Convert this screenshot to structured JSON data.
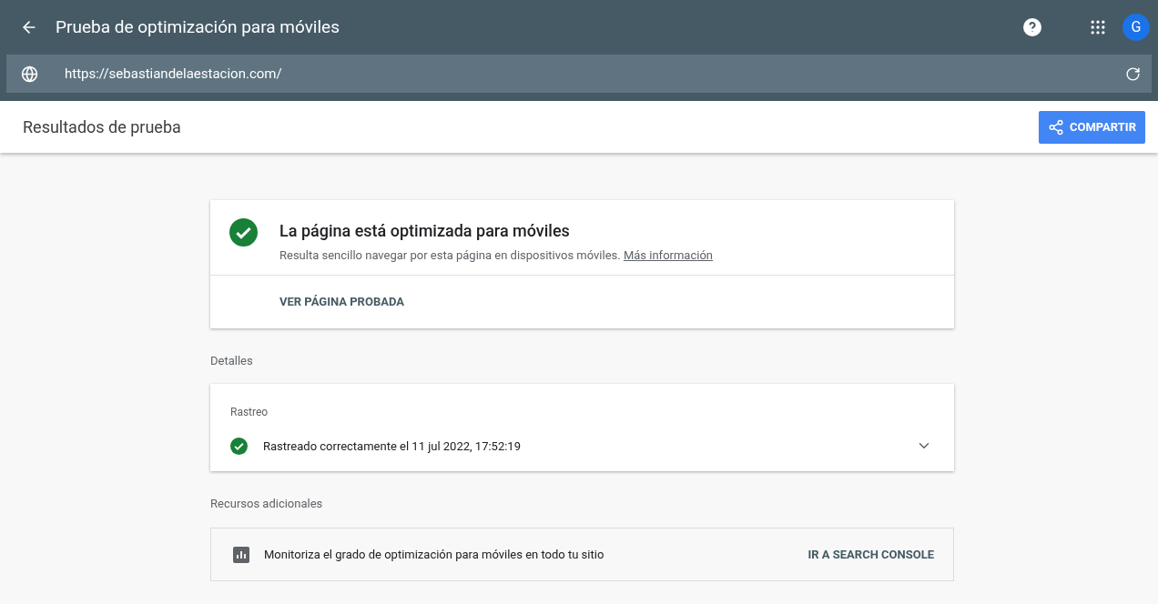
{
  "app_bar": {
    "title": "Prueba de optimización para móviles",
    "avatar": "G"
  },
  "url_bar": {
    "value": "https://sebastiandelaestacion.com/"
  },
  "results_header": {
    "title": "Resultados de prueba",
    "share_button": "COMPARTIR"
  },
  "verdict": {
    "title": "La página está optimizada para móviles",
    "description": "Resulta sencillo navegar por esta página en dispositivos móviles.",
    "link": "Más información",
    "action": "VER PÁGINA PROBADA"
  },
  "details": {
    "heading": "Detalles",
    "card_title": "Rastreo",
    "status": "Rastreado correctamente el 11 jul 2022, 17:52:19",
    "expanded": false
  },
  "resources": {
    "heading": "Recursos adicionales",
    "text": "Monitoriza el grado de optimización para móviles en todo tu sitio",
    "action": "IR A SEARCH CONSOLE"
  }
}
